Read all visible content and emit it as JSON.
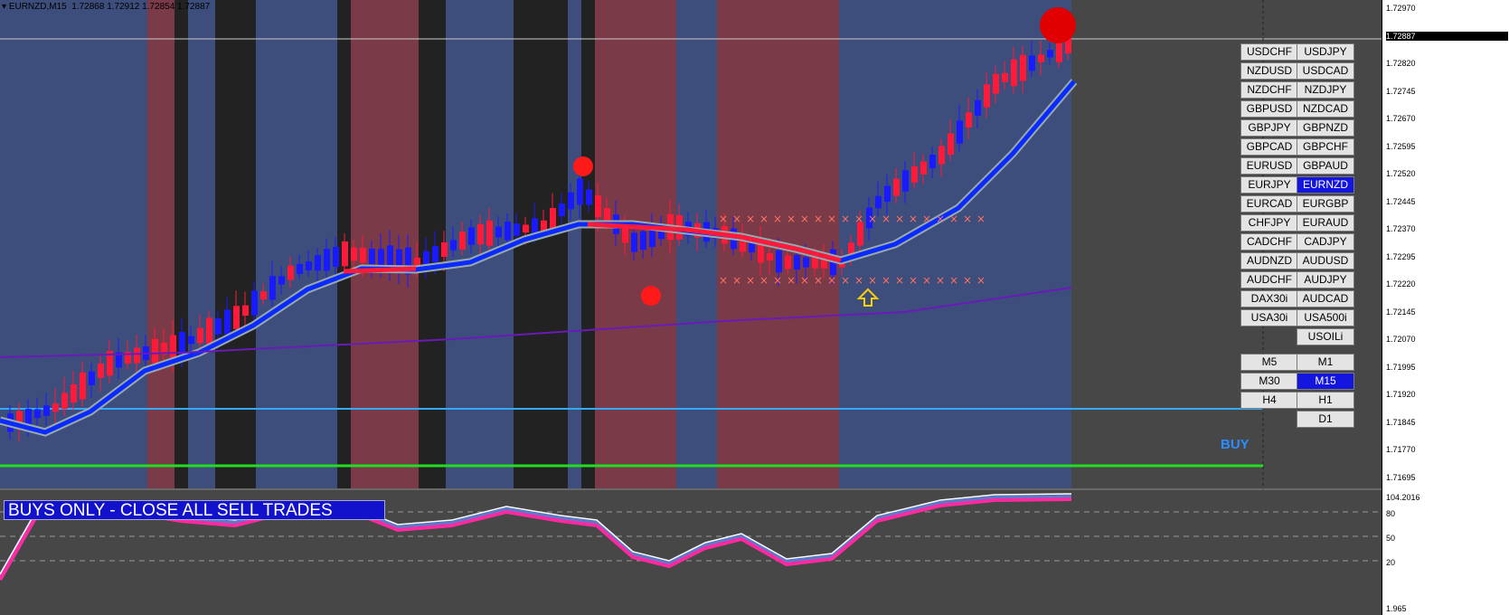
{
  "header": {
    "symbol": "EURNZD,M15",
    "ohlc": "1.72868 1.72912 1.72854 1.72887"
  },
  "banner": "BUYS ONLY - CLOSE ALL SELL TRADES",
  "signal_label": "BUY",
  "price_axis": [
    "1.72970",
    "1.72887",
    "1.72820",
    "1.72745",
    "1.72670",
    "1.72595",
    "1.72520",
    "1.72445",
    "1.72370",
    "1.72295",
    "1.72220",
    "1.72145",
    "1.72070",
    "1.71995",
    "1.71920",
    "1.71845",
    "1.71770",
    "1.71695"
  ],
  "oscillator_axis": [
    "104.2016",
    "80",
    "50",
    "20",
    "1.965"
  ],
  "symbols": [
    [
      "USDCHF",
      "USDJPY"
    ],
    [
      "NZDUSD",
      "USDCAD"
    ],
    [
      "NZDCHF",
      "NZDJPY"
    ],
    [
      "GBPUSD",
      "NZDCAD"
    ],
    [
      "GBPJPY",
      "GBPNZD"
    ],
    [
      "GBPCAD",
      "GBPCHF"
    ],
    [
      "EURUSD",
      "GBPAUD"
    ],
    [
      "EURJPY",
      "EURNZD"
    ],
    [
      "EURCAD",
      "EURGBP"
    ],
    [
      "CHFJPY",
      "EURAUD"
    ],
    [
      "CADCHF",
      "CADJPY"
    ],
    [
      "AUDNZD",
      "AUDUSD"
    ],
    [
      "AUDCHF",
      "AUDJPY"
    ],
    [
      "DAX30i",
      "AUDCAD"
    ],
    [
      "USA30i",
      "USA500i"
    ],
    [
      "",
      "USOILi"
    ]
  ],
  "active_symbol": "EURNZD",
  "timeframes": [
    [
      "M5",
      "M1"
    ],
    [
      "M30",
      "M15"
    ],
    [
      "H4",
      "H1"
    ],
    [
      "",
      "D1"
    ]
  ],
  "active_timeframe": "M15",
  "colors": {
    "bull": "#1a1aff",
    "bear": "#ff1a3a",
    "bg_blue": "#3d4d7c",
    "bg_red": "#7a3a48",
    "bg_black": "#222222",
    "ma": "#0a2aff",
    "slow_ma": "#6a1ab8",
    "buy_line": "#33aaff",
    "green_line": "#22dd22"
  }
}
